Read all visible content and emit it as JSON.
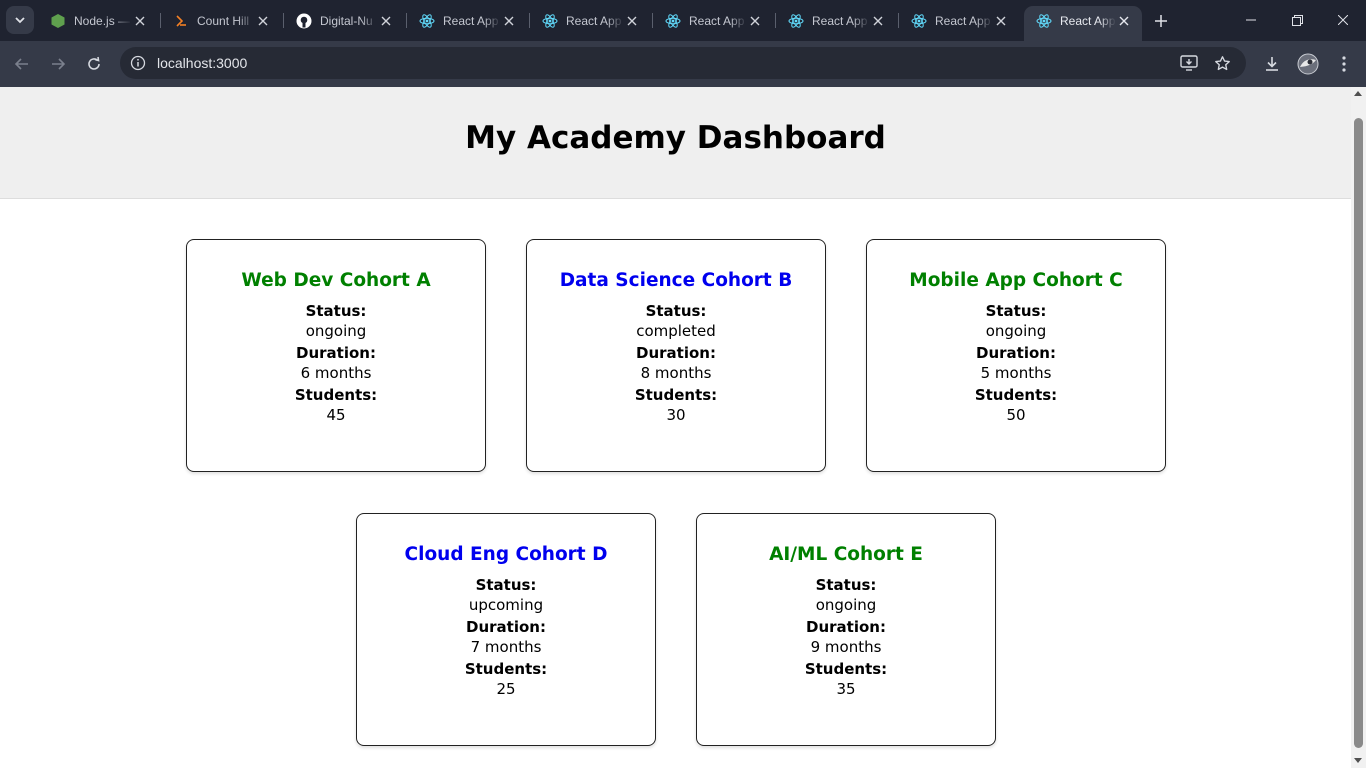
{
  "browser": {
    "tabs": [
      {
        "title": "Node.js —",
        "icon": "nodejs-icon"
      },
      {
        "title": "Count Hill",
        "icon": "codeforces-icon"
      },
      {
        "title": "Digital-Nu",
        "icon": "github-icon"
      },
      {
        "title": "React App",
        "icon": "react-icon"
      },
      {
        "title": "React App",
        "icon": "react-icon"
      },
      {
        "title": "React App",
        "icon": "react-icon"
      },
      {
        "title": "React App",
        "icon": "react-icon"
      },
      {
        "title": "React App",
        "icon": "react-icon"
      },
      {
        "title": "React App",
        "icon": "react-icon",
        "active": true
      }
    ],
    "url": "localhost:3000"
  },
  "page": {
    "title": "My Academy Dashboard",
    "labels": {
      "status": "Status:",
      "duration": "Duration:",
      "students": "Students:"
    },
    "cohorts": [
      {
        "name": "Web Dev Cohort A",
        "status": "ongoing",
        "duration": "6 months",
        "students": "45",
        "color": "#008000"
      },
      {
        "name": "Data Science Cohort B",
        "status": "completed",
        "duration": "8 months",
        "students": "30",
        "color": "#0000ee"
      },
      {
        "name": "Mobile App Cohort C",
        "status": "ongoing",
        "duration": "5 months",
        "students": "50",
        "color": "#008000"
      },
      {
        "name": "Cloud Eng Cohort D",
        "status": "upcoming",
        "duration": "7 months",
        "students": "25",
        "color": "#0000ee"
      },
      {
        "name": "AI/ML Cohort E",
        "status": "ongoing",
        "duration": "9 months",
        "students": "35",
        "color": "#008000"
      }
    ]
  },
  "colors": {
    "tabstrip_bg": "#1f2330",
    "toolbar_bg": "#353a48",
    "header_bg": "#efefef",
    "green": "#008000",
    "blue": "#0000ee"
  }
}
